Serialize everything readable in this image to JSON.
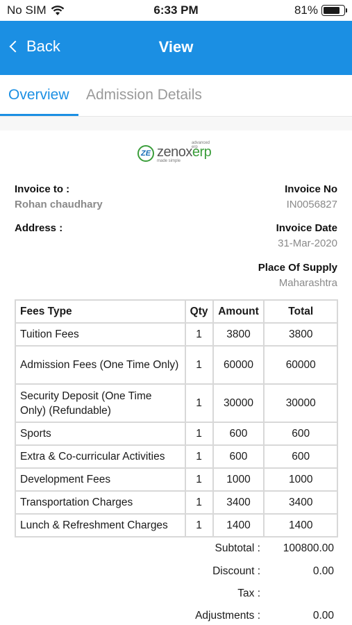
{
  "status_bar": {
    "carrier": "No SIM",
    "time": "6:33 PM",
    "battery": "81%",
    "battery_level": 0.81
  },
  "nav": {
    "back_label": "Back",
    "title": "View"
  },
  "tabs": [
    {
      "label": "Overview",
      "active": true
    },
    {
      "label": "Admission Details",
      "active": false
    }
  ],
  "logo": {
    "mark": "ZE",
    "word_a": "zenox",
    "word_b": "erp",
    "tag_top": "advanced erp",
    "tag_bottom": "made simple"
  },
  "invoice": {
    "to_label": "Invoice to :",
    "to_value": "Rohan chaudhary",
    "address_label": "Address :",
    "no_label": "Invoice No",
    "no_value": "IN0056827",
    "date_label": "Invoice Date",
    "date_value": "31-Mar-2020",
    "supply_label": "Place Of Supply",
    "supply_value": "Maharashtra"
  },
  "table": {
    "headers": [
      "Fees Type",
      "Qty",
      "Amount",
      "Total"
    ],
    "rows": [
      {
        "type": "Tuition Fees",
        "qty": "1",
        "amount": "3800",
        "total": "3800"
      },
      {
        "type": "Admission Fees (One Time Only)",
        "qty": "1",
        "amount": "60000",
        "total": "60000"
      },
      {
        "type": "Security Deposit (One Time Only) (Refundable)",
        "qty": "1",
        "amount": "30000",
        "total": "30000"
      },
      {
        "type": "Sports",
        "qty": "1",
        "amount": "600",
        "total": "600"
      },
      {
        "type": "Extra & Co-curricular Activities",
        "qty": "1",
        "amount": "600",
        "total": "600"
      },
      {
        "type": "Development Fees",
        "qty": "1",
        "amount": "1000",
        "total": "1000"
      },
      {
        "type": "Transportation Charges",
        "qty": "1",
        "amount": "3400",
        "total": "3400"
      },
      {
        "type": "Lunch & Refreshment Charges",
        "qty": "1",
        "amount": "1400",
        "total": "1400"
      }
    ]
  },
  "totals": {
    "subtotal_label": "Subtotal :",
    "subtotal_value": "100800.00",
    "discount_label": "Discount :",
    "discount_value": "0.00",
    "tax_label": "Tax :",
    "tax_value": "",
    "adjustments_label": "Adjustments :",
    "adjustments_value": "0.00"
  },
  "colors": {
    "accent": "#1b8fe3",
    "muted_text": "#8a8a8a",
    "border": "#d8d8d8"
  }
}
